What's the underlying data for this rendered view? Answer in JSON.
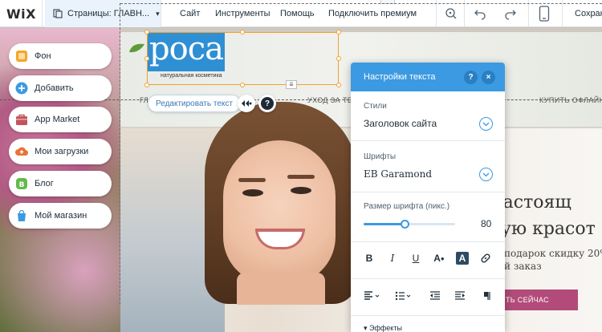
{
  "topbar": {
    "logo": "WiX",
    "pages_label": "Страницы: ГЛАВН...",
    "menu": [
      "Сайт",
      "Инструменты",
      "Помощь",
      "Подключить премиум"
    ],
    "save_label": "Сохран",
    "icons": [
      "page-icon",
      "zoom-icon",
      "undo-icon",
      "redo-icon",
      "mobile-icon"
    ]
  },
  "left_panel": {
    "items": [
      {
        "label": "Фон",
        "icon": "background-icon",
        "color": "#f5a623"
      },
      {
        "label": "Добавить",
        "icon": "add-icon",
        "color": "#3b9ae1"
      },
      {
        "label": "App Market",
        "icon": "app-market-icon",
        "color": "#c2555b"
      },
      {
        "label": "Мои загрузки",
        "icon": "upload-icon",
        "color": "#e8733a"
      },
      {
        "label": "Блог",
        "icon": "blog-icon",
        "color": "#63b94c"
      },
      {
        "label": "Мой магазин",
        "icon": "store-icon",
        "color": "#3b9ae1"
      }
    ]
  },
  "site": {
    "logo_text": "роса",
    "logo_sub": "натуральная косметика",
    "nav": [
      "ГЛ",
      "УХОД ЗА ТЕЛ",
      "КУПИТЬ ОФЛАЙН"
    ],
    "edit_text_label": "Редактировать текст",
    "help_glyph": "?",
    "headline_1": "настоящ",
    "headline_2": "ую красот",
    "sub_1": "подарок скидку 20%",
    "sub_2": "й заказ",
    "cta": "ТЬ СЕЙЧАС",
    "accent": "#b24b7a"
  },
  "text_settings": {
    "title": "Настройки текста",
    "help_glyph": "?",
    "close_glyph": "×",
    "style_label": "Стили",
    "style_value": "Заголовок сайта",
    "font_label": "Шрифты",
    "font_value": "EB Garamond",
    "size_label": "Размер шрифта (пикс.)",
    "size_value": "80",
    "size_fraction": 0.45,
    "format_buttons": [
      {
        "glyph": "B",
        "name": "bold-icon"
      },
      {
        "glyph": "I",
        "name": "italic-icon"
      },
      {
        "glyph": "U",
        "name": "underline-icon"
      },
      {
        "glyph": "A",
        "name": "text-color-icon"
      },
      {
        "glyph": "A",
        "name": "highlight-icon"
      },
      {
        "glyph": "",
        "name": "link-icon"
      }
    ],
    "effects_label": "▾ Эффекты",
    "accent": "#3b9ae1"
  }
}
